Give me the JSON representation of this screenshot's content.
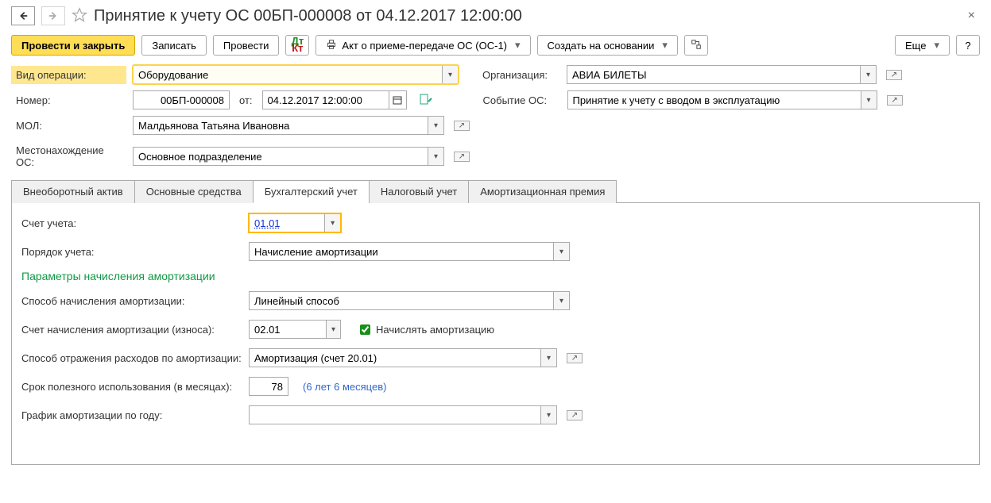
{
  "title": "Принятие к учету ОС 00БП-000008 от 04.12.2017 12:00:00",
  "toolbar": {
    "post_close": "Провести и закрыть",
    "write": "Записать",
    "post": "Провести",
    "act": "Акт о приеме-передаче ОС (ОС-1)",
    "create_based": "Создать на основании",
    "more": "Еще",
    "help": "?"
  },
  "header": {
    "op_type_label": "Вид операции:",
    "op_type_value": "Оборудование",
    "org_label": "Организация:",
    "org_value": "АВИА БИЛЕТЫ",
    "num_label": "Номер:",
    "num_value": "00БП-000008",
    "from_label": "от:",
    "date_value": "04.12.2017 12:00:00",
    "event_label": "Событие ОС:",
    "event_value": "Принятие к учету с вводом в эксплуатацию",
    "mol_label": "МОЛ:",
    "mol_value": "Малдьянова Татьяна Ивановна",
    "loc_label": "Местонахождение ОС:",
    "loc_value": "Основное подразделение"
  },
  "tabs": [
    "Внеоборотный актив",
    "Основные средства",
    "Бухгалтерский учет",
    "Налоговый учет",
    "Амортизационная премия"
  ],
  "panel": {
    "account_label": "Счет учета:",
    "account_value": "01.01",
    "proc_label": "Порядок учета:",
    "proc_value": "Начисление амортизации",
    "section": "Параметры начисления амортизации",
    "method_label": "Способ начисления амортизации:",
    "method_value": "Линейный способ",
    "amort_acc_label": "Счет начисления амортизации (износа):",
    "amort_acc_value": "02.01",
    "calc_amort_label": "Начислять амортизацию",
    "expense_label": "Способ отражения расходов по амортизации:",
    "expense_value": "Амортизация (счет 20.01)",
    "life_label": "Срок полезного использования (в месяцах):",
    "life_value": "78",
    "life_hint": "(6 лет 6 месяцев)",
    "sched_label": "График амортизации по году:",
    "sched_value": ""
  }
}
